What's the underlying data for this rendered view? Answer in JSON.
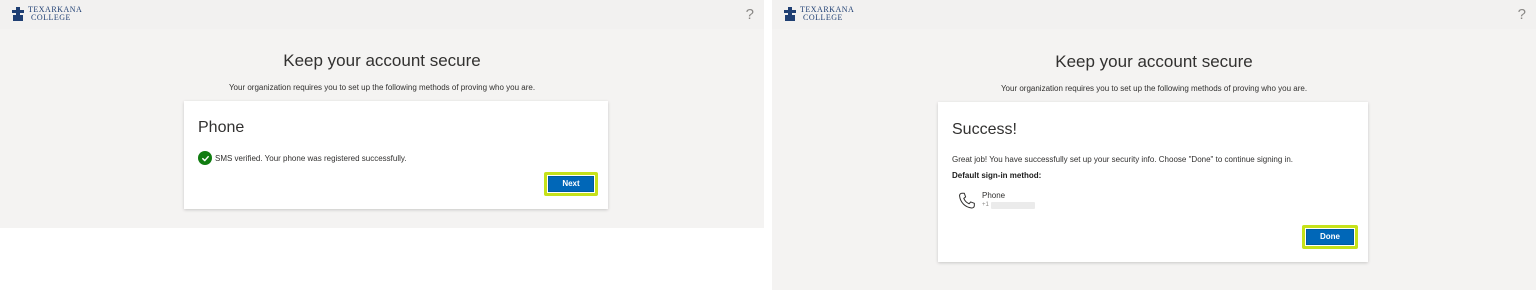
{
  "left": {
    "logo": {
      "line1": "TEXARKANA",
      "line2": "COLLEGE"
    },
    "help_label": "?",
    "heading": "Keep your account secure",
    "subheading": "Your organization requires you to set up the following methods of proving who you are.",
    "card": {
      "title": "Phone",
      "status_text": "SMS verified. Your phone was registered successfully.",
      "next_label": "Next"
    }
  },
  "right": {
    "logo": {
      "line1": "TEXARKANA",
      "line2": "COLLEGE"
    },
    "help_label": "?",
    "heading": "Keep your account secure",
    "subheading": "Your organization requires you to set up the following methods of proving who you are.",
    "card": {
      "title": "Success!",
      "message": "Great job! You have successfully set up your security info. Choose \"Done\" to continue signing in.",
      "default_label": "Default sign-in method:",
      "method_name": "Phone",
      "method_prefix": "+1",
      "done_label": "Done"
    }
  },
  "colors": {
    "primary_button": "#0067b8",
    "highlight": "#c6e21a",
    "success_check": "#107c10",
    "logo_blue": "#1f3f73"
  }
}
